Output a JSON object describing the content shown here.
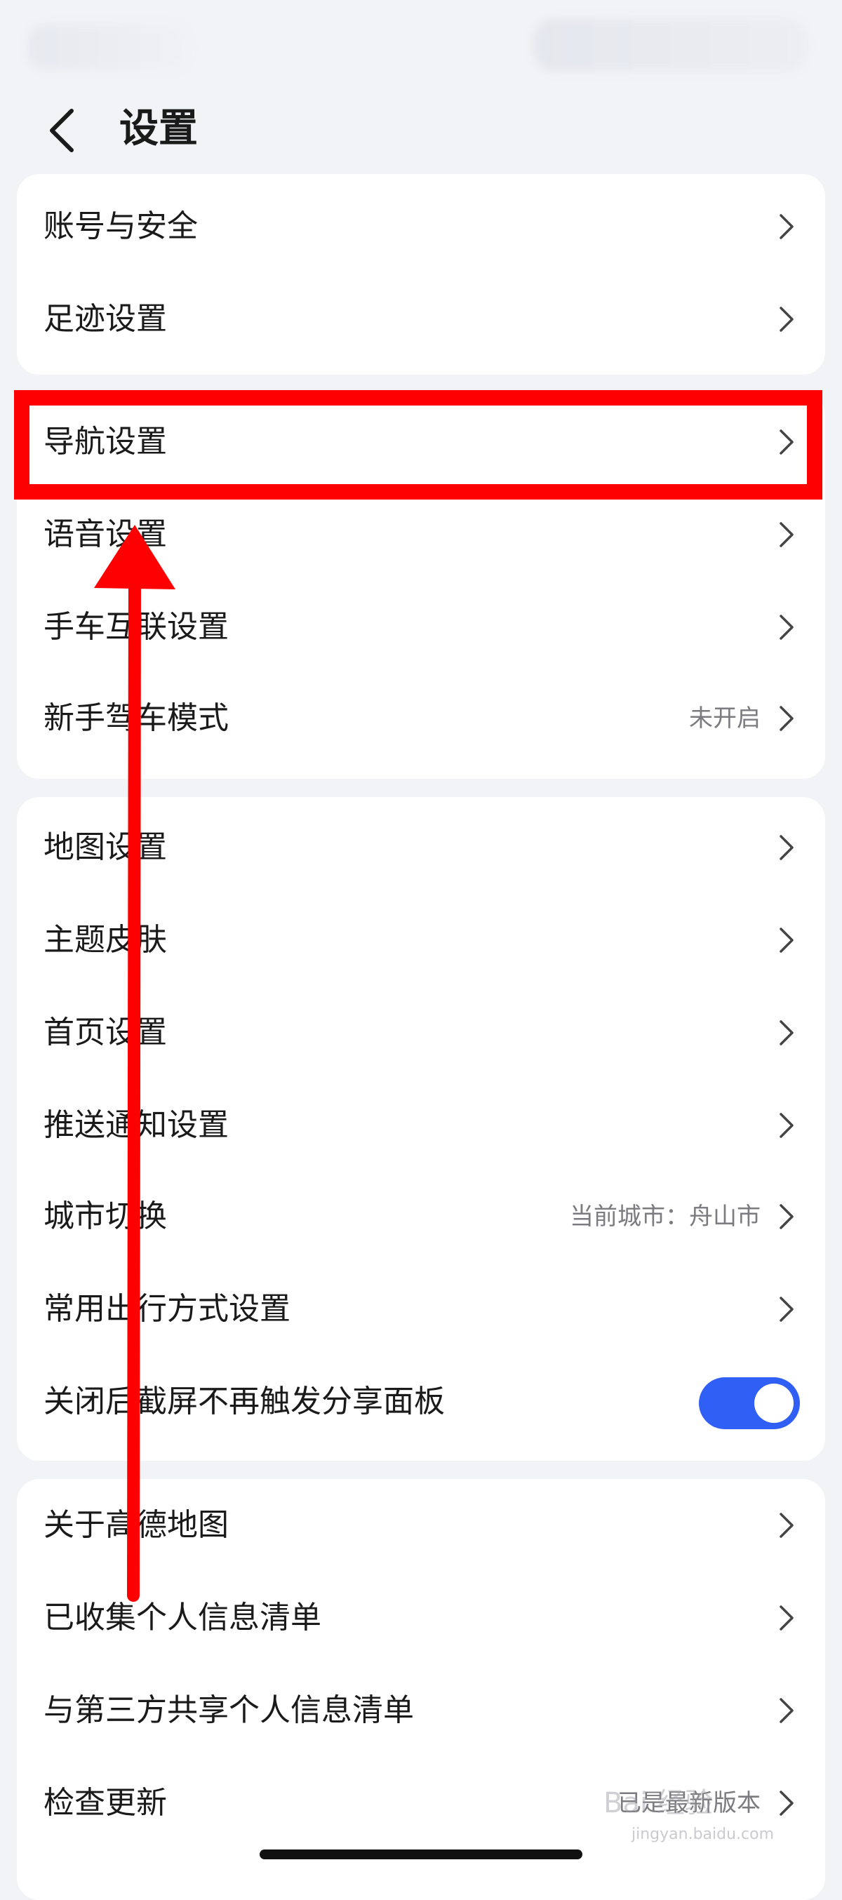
{
  "header": {
    "title": "设置"
  },
  "groups": [
    {
      "items": [
        {
          "label": "账号与安全"
        },
        {
          "label": "足迹设置"
        }
      ]
    },
    {
      "items": [
        {
          "label": "导航设置"
        },
        {
          "label": "语音设置"
        },
        {
          "label": "手车互联设置"
        },
        {
          "label": "新手驾车模式",
          "value": "未开启"
        }
      ]
    },
    {
      "items": [
        {
          "label": "地图设置"
        },
        {
          "label": "主题皮肤"
        },
        {
          "label": "首页设置"
        },
        {
          "label": "推送通知设置"
        },
        {
          "label": "城市切换",
          "value": "当前城市：舟山市"
        },
        {
          "label": "常用出行方式设置"
        },
        {
          "label": "关闭后截屏不再触发分享面板",
          "toggle_on": true
        }
      ]
    },
    {
      "items": [
        {
          "label": "关于高德地图"
        },
        {
          "label": "已收集个人信息清单"
        },
        {
          "label": "与第三方共享个人信息清单"
        },
        {
          "label": "检查更新",
          "value": "已是最新版本"
        }
      ]
    }
  ],
  "annotation": {
    "highlight_color": "#ff0000",
    "highlighted_item": "导航设置"
  },
  "colors": {
    "toggle_on": "#2f5ff5",
    "background": "#f2f3f7"
  },
  "watermark": {
    "logo": "Bai 经验",
    "domain": "jingyan.baidu.com"
  }
}
